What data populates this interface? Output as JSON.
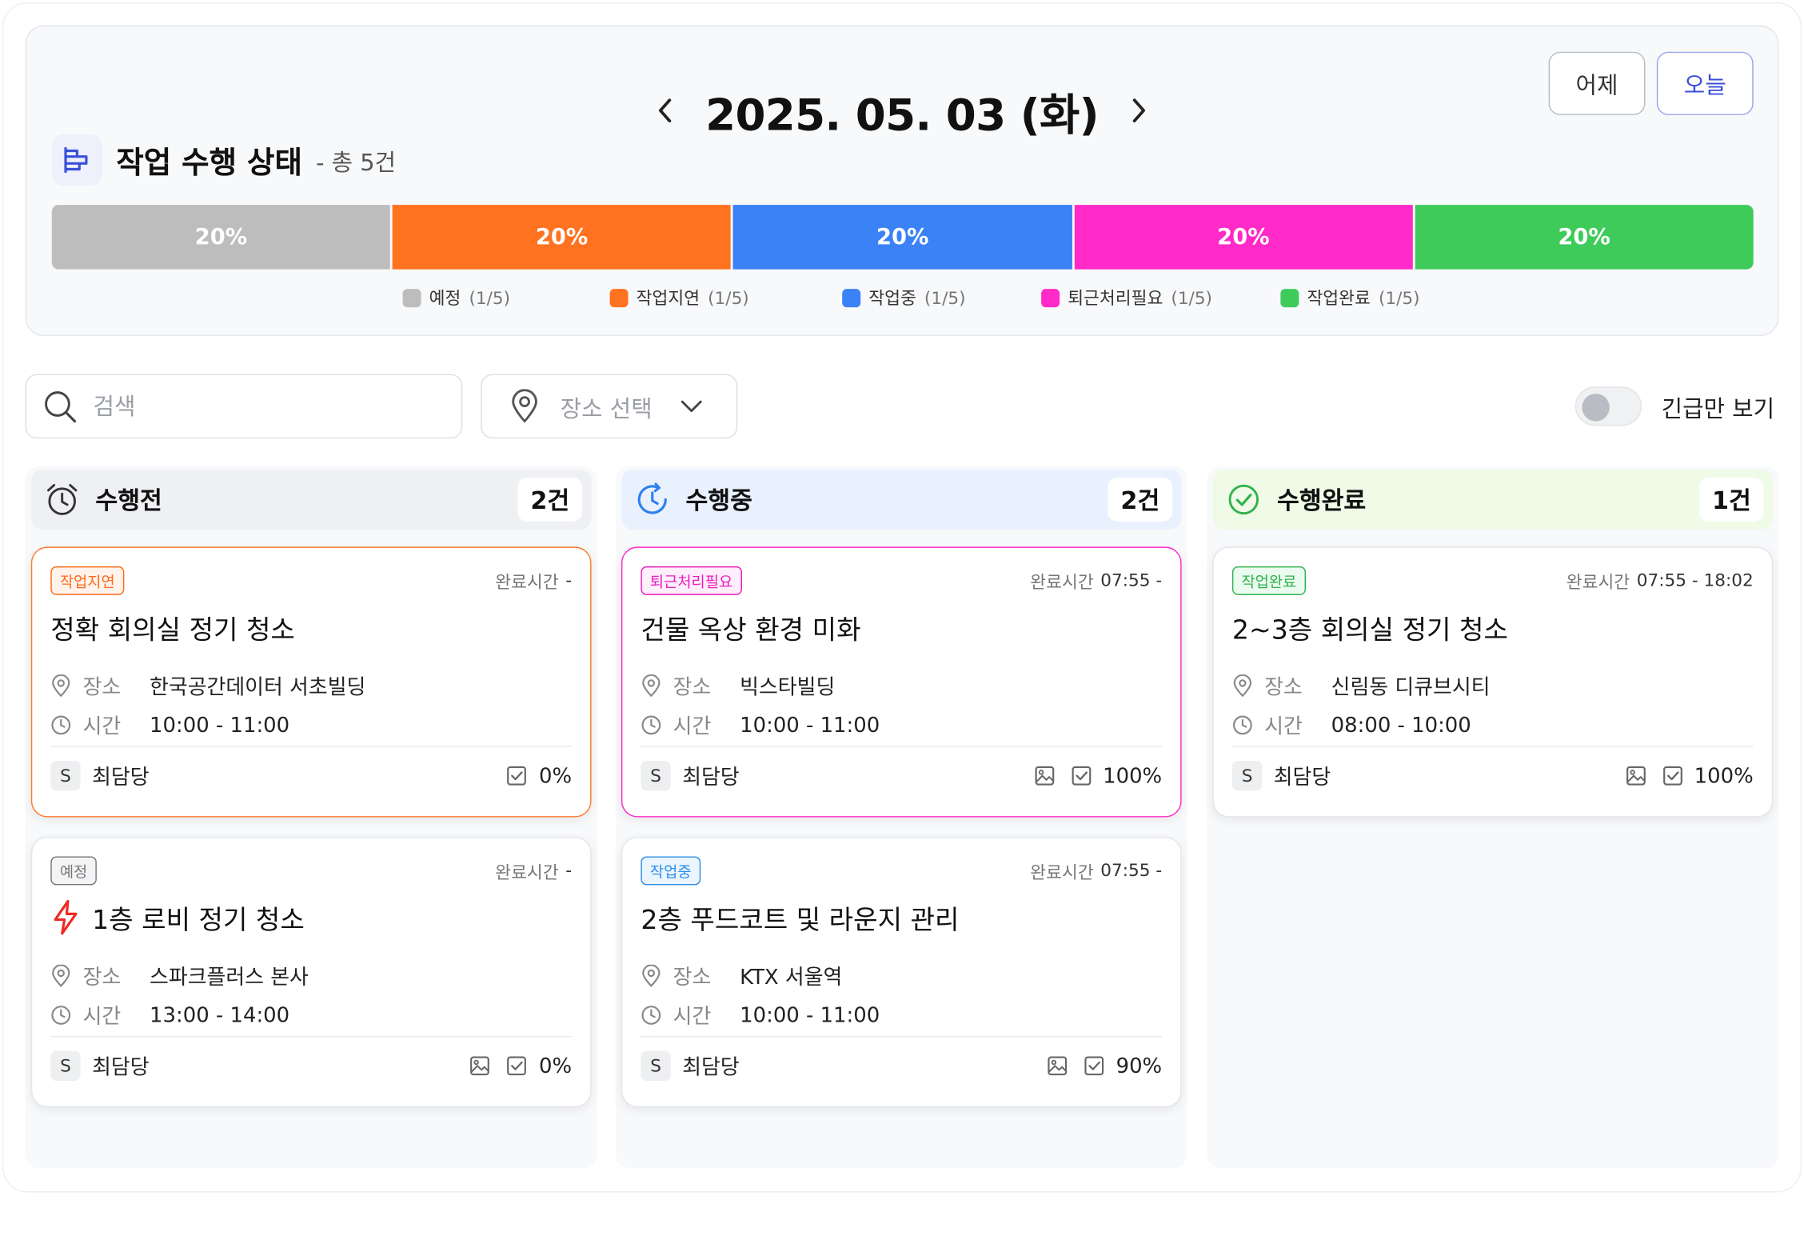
{
  "date": {
    "label": "2025. 05. 03 (화)"
  },
  "buttons": {
    "yesterday": "어제",
    "today": "오늘"
  },
  "status": {
    "title": "작업 수행 상태",
    "total": "- 총 5건",
    "segments": [
      {
        "label": "예정",
        "percent_label": "20%",
        "count": "(1/5)",
        "color": "#bdbdbd"
      },
      {
        "label": "작업지연",
        "percent_label": "20%",
        "count": "(1/5)",
        "color": "#ff7220"
      },
      {
        "label": "작업중",
        "percent_label": "20%",
        "count": "(1/5)",
        "color": "#3b82f6"
      },
      {
        "label": "퇴근처리필요",
        "percent_label": "20%",
        "count": "(1/5)",
        "color": "#ff2ac8"
      },
      {
        "label": "작업완료",
        "percent_label": "20%",
        "count": "(1/5)",
        "color": "#3ecb5a"
      }
    ]
  },
  "filters": {
    "search_placeholder": "검색",
    "place_select": "장소 선택",
    "urgent_label": "긴급만 보기",
    "urgent_on": false
  },
  "columns": [
    {
      "title": "수행전",
      "count": "2건",
      "icon": "alarm-clock-icon",
      "header_color": "#eff0f3",
      "cards": [
        {
          "badge": "작업지연",
          "badge_color": "#ff6a1a",
          "badge_bg": "#fff3eb",
          "border_color": "#ff7a2e",
          "done_label": "완료시간",
          "done_value": "-",
          "title": "정확 회의실 정기 청소",
          "urgent": false,
          "place_key": "장소",
          "place": "한국공간데이터 서초빌딩",
          "time_key": "시간",
          "time": "10:00 - 11:00",
          "avatar": "S",
          "assignee": "최담당",
          "has_image": false,
          "progress": "0%"
        },
        {
          "badge": "예정",
          "badge_color": "#777777",
          "badge_bg": "#f3f4f6",
          "border_color": "#e4e6ea",
          "done_label": "완료시간",
          "done_value": "-",
          "title": "1층 로비 정기 청소",
          "urgent": true,
          "place_key": "장소",
          "place": "스파크플러스 본사",
          "time_key": "시간",
          "time": "13:00 - 14:00",
          "avatar": "S",
          "assignee": "최담당",
          "has_image": true,
          "progress": "0%"
        }
      ]
    },
    {
      "title": "수행중",
      "count": "2건",
      "icon": "refresh-clock-icon",
      "header_color": "#e9f1fe",
      "cards": [
        {
          "badge": "퇴근처리필요",
          "badge_color": "#e81cc0",
          "badge_bg": "#ffeefb",
          "border_color": "#ff2ac8",
          "done_label": "완료시간",
          "done_value": "07:55 -",
          "title": "건물 옥상 환경 미화",
          "urgent": false,
          "place_key": "장소",
          "place": "빅스타빌딩",
          "time_key": "시간",
          "time": "10:00 - 11:00",
          "avatar": "S",
          "assignee": "최담당",
          "has_image": true,
          "progress": "100%"
        },
        {
          "badge": "작업중",
          "badge_color": "#2f8ee8",
          "badge_bg": "#eaf5ff",
          "border_color": "#e4e6ea",
          "done_label": "완료시간",
          "done_value": "07:55 -",
          "title": "2층 푸드코트 및 라운지 관리",
          "urgent": false,
          "place_key": "장소",
          "place": "KTX 서울역",
          "time_key": "시간",
          "time": "10:00 - 11:00",
          "avatar": "S",
          "assignee": "최담당",
          "has_image": true,
          "progress": "90%"
        }
      ]
    },
    {
      "title": "수행완료",
      "count": "1건",
      "icon": "check-circle-icon",
      "header_color": "#effbe6",
      "cards": [
        {
          "badge": "작업완료",
          "badge_color": "#2fb24c",
          "badge_bg": "#ecfbef",
          "border_color": "#e4e6ea",
          "done_label": "완료시간",
          "done_value": "07:55 - 18:02",
          "title": "2~3층 회의실 정기 청소",
          "urgent": false,
          "place_key": "장소",
          "place": "신림동 디큐브시티",
          "time_key": "시간",
          "time": "08:00 - 10:00",
          "avatar": "S",
          "assignee": "최담당",
          "has_image": true,
          "progress": "100%"
        }
      ]
    }
  ]
}
